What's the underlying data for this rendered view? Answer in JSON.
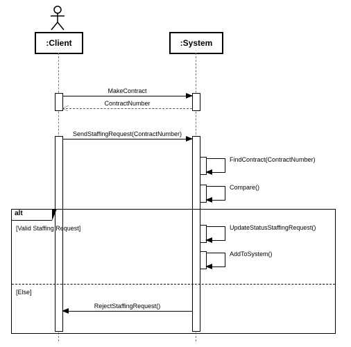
{
  "chart_data": {
    "type": "uml-sequence",
    "participants": [
      "Client",
      "System"
    ],
    "messages": [
      {
        "from": "Client",
        "to": "System",
        "text": "MakeContract",
        "style": "sync"
      },
      {
        "from": "System",
        "to": "Client",
        "text": "ContractNumber",
        "style": "return"
      },
      {
        "from": "Client",
        "to": "System",
        "text": "SendStaffingRequest(ContractNumber)",
        "style": "sync"
      },
      {
        "from": "System",
        "to": "System",
        "text": "FindContract(ContractNumber)",
        "style": "self"
      },
      {
        "from": "System",
        "to": "System",
        "text": "Compare()",
        "style": "self"
      }
    ],
    "fragment": {
      "operator": "alt",
      "operands": [
        {
          "guard": "[Valid Staffing Request]",
          "messages": [
            {
              "from": "System",
              "to": "System",
              "text": "UpdateStatusStaffingRequest()",
              "style": "self"
            },
            {
              "from": "System",
              "to": "System",
              "text": "AddToSystem()",
              "style": "self"
            }
          ]
        },
        {
          "guard": "[Else]",
          "messages": [
            {
              "from": "System",
              "to": "Client",
              "text": "RejectStaffingRequest()",
              "style": "sync"
            }
          ]
        }
      ]
    }
  },
  "heads": {
    "client": ":Client",
    "system": ":System"
  },
  "labels": {
    "makeContract": "MakeContract",
    "contractNumber": "ContractNumber",
    "sendStaffing": "SendStaffingRequest(ContractNumber)",
    "findContract": "FindContract(ContractNumber)",
    "compare": "Compare()",
    "updateStatus": "UpdateStatusStaffingRequest()",
    "addToSystem": "AddToSystem()",
    "reject": "RejectStaffingRequest()"
  },
  "frag": {
    "operator": "alt",
    "guard1": "[Valid Staffing Request]",
    "guard2": "[Else]"
  }
}
